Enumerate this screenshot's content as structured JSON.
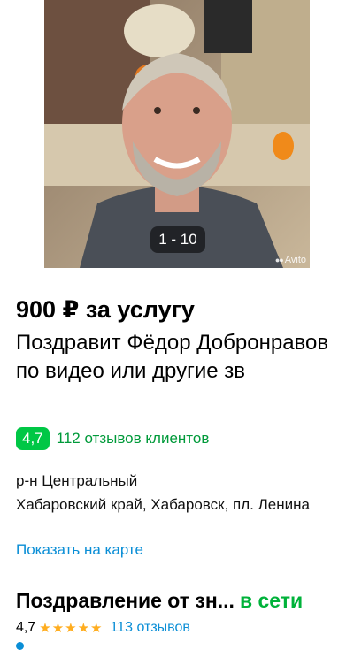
{
  "gallery": {
    "counter": "1 - 10",
    "watermark": "Avito"
  },
  "listing": {
    "price": "900 ₽ за услугу",
    "title": "Поздравит Фёдор Добронравов по видео или другие зв"
  },
  "rating": {
    "value": "4,7",
    "reviews_label": "112 отзывов клиентов"
  },
  "address": {
    "district": "р-н Центральный",
    "full": "Хабаровский край, Хабаровск, пл. Ленина",
    "map_link": "Показать на карте"
  },
  "seller": {
    "name": "Поздравление от зн...",
    "status": "в сети",
    "rating": "4,7",
    "stars": "★★★★★",
    "reviews": "113 отзывов"
  },
  "colors": {
    "accent_green": "#00c745",
    "link_blue": "#0a8ed6",
    "online_green": "#00b23a"
  }
}
